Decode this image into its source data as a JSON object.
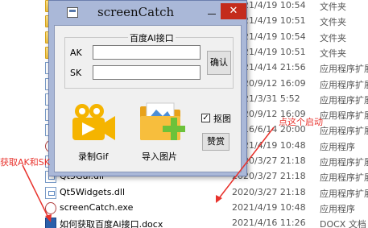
{
  "explorer": {
    "rows": [
      {
        "name": "",
        "date": "2021/4/19 10:54",
        "type": "文件夹",
        "icon": "folder-icon"
      },
      {
        "name": "",
        "date": "2021/4/19 10:51",
        "type": "文件夹",
        "icon": "folder-icon"
      },
      {
        "name": "",
        "date": "2021/4/19 10:54",
        "type": "文件夹",
        "icon": "folder-icon"
      },
      {
        "name": "",
        "date": "2021/4/19 10:51",
        "type": "文件夹",
        "icon": "folder-icon"
      },
      {
        "name": "",
        "date": "2021/4/14 21:56",
        "type": "应用程序扩展",
        "icon": "file-icon"
      },
      {
        "name": "",
        "date": "2020/9/12 16:09",
        "type": "应用程序扩展",
        "icon": "file-icon"
      },
      {
        "name": "",
        "date": "2021/3/31 5:52",
        "type": "应用程序扩展",
        "icon": "file-icon"
      },
      {
        "name": "",
        "date": "2020/9/12 16:09",
        "type": "应用程序扩展",
        "icon": "file-icon"
      },
      {
        "name": "",
        "date": "2016/6/14 20:00",
        "type": "应用程序扩展",
        "icon": "file-icon"
      },
      {
        "name": "",
        "date": "2021/4/19 10:48",
        "type": "应用程序",
        "icon": "exe-icon"
      },
      {
        "name": "",
        "date": "2020/3/27 21:18",
        "type": "应用程序扩展",
        "icon": "file-icon"
      },
      {
        "name": "Qt5Gui.dll",
        "date": "2020/3/27 21:18",
        "type": "应用程序扩展",
        "icon": "file-icon"
      },
      {
        "name": "Qt5Widgets.dll",
        "date": "2020/3/27 21:18",
        "type": "应用程序扩展",
        "icon": "file-icon"
      },
      {
        "name": "screenCatch.exe",
        "date": "2021/4/19 10:48",
        "type": "应用程序",
        "icon": "exe-icon"
      },
      {
        "name": "如何获取百度Ai接口.docx",
        "date": "2021/4/16 11:26",
        "type": "DOCX 文档",
        "icon": "docx-icon"
      }
    ]
  },
  "dialog": {
    "title": "screenCatch",
    "close_glyph": "✕",
    "group_label": "百度AI接口",
    "ak_label": "AK",
    "sk_label": "SK",
    "ak_value": "",
    "sk_value": "",
    "confirm_label": "确认",
    "record_gif_label": "录制Gif",
    "import_image_label": "导入图片",
    "capture_checkbox_label": "抠图",
    "capture_checked": true,
    "capture_glyph": "✓",
    "donate_label": "赞赏"
  },
  "annotations": {
    "start_hint": "点这个启动",
    "ak_hint": "获取AK和SK"
  },
  "colors": {
    "accent_red": "#e8322c",
    "close_red": "#c42b1c",
    "dialog_frame": "#aab8d8"
  }
}
